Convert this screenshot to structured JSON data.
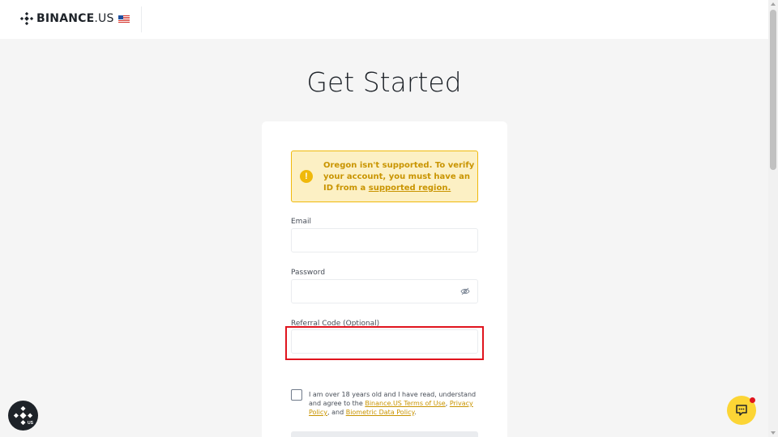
{
  "header": {
    "brand": "BINANCE",
    "brand_suffix": ".US",
    "flag": "us-flag-icon"
  },
  "page": {
    "title": "Get Started"
  },
  "alert": {
    "icon": "warning-icon",
    "text": "Oregon isn't supported. To verify your account, you must have an ID from a",
    "link": "supported region."
  },
  "form": {
    "email_label": "Email",
    "email_value": "",
    "password_label": "Password",
    "password_value": "",
    "referral_label": "Referral Code (Optional)",
    "referral_value": "",
    "terms_prefix": "I am over 18 years old and I have read, understand and agree to the",
    "terms_link": "Binance.US Terms of Use",
    "terms_sep1": ",",
    "privacy_link": "Privacy Policy",
    "terms_sep2": ", and",
    "biometric_link": "Biometric Data Policy",
    "terms_end": "."
  },
  "colors": {
    "accent": "#f0b90b",
    "alert_bg": "#fcf0c4",
    "alert_text": "#c99400",
    "highlight": "#e0141e",
    "chat_button": "#fcd535"
  }
}
